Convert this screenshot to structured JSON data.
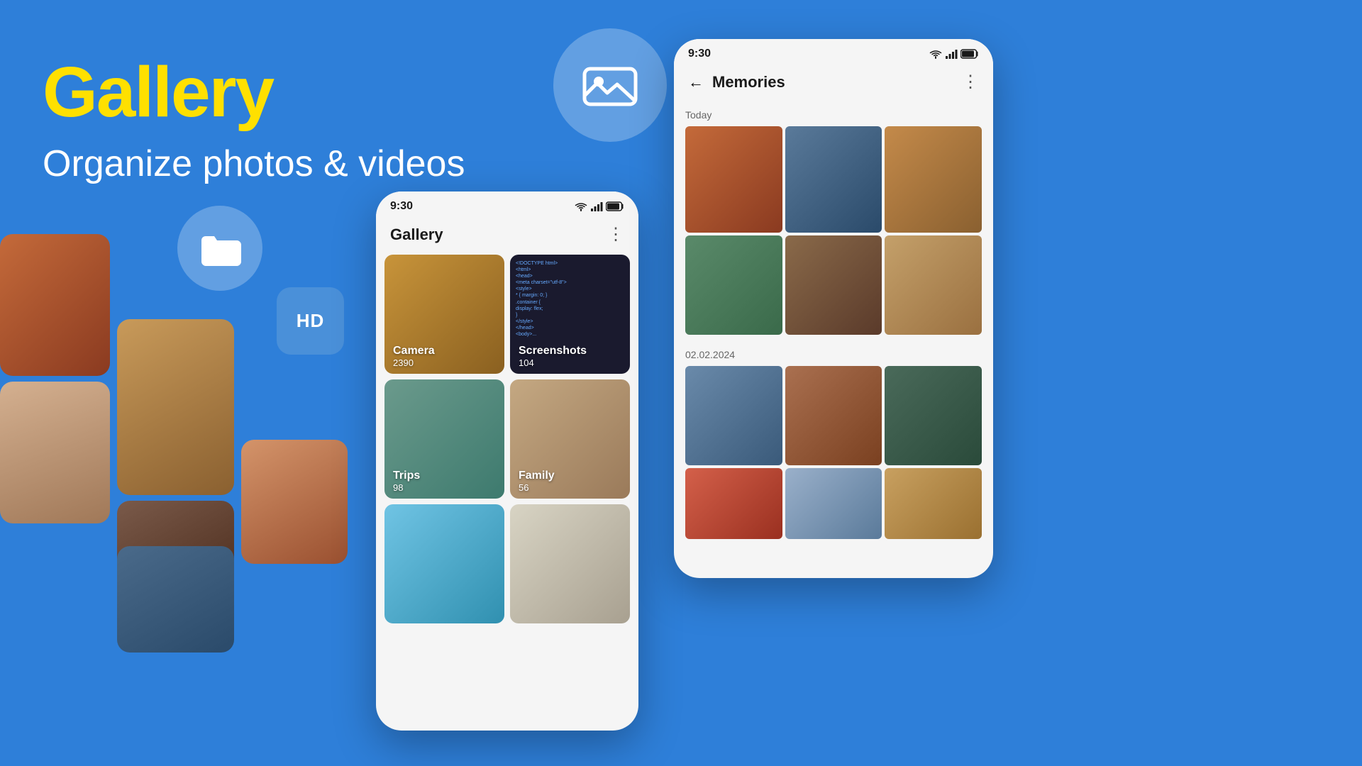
{
  "app": {
    "title": "Gallery",
    "subtitle": "Organize photos & videos",
    "bg_color": "#2E7FD9"
  },
  "icons": {
    "gallery_icon": "🖼",
    "folder_icon": "📁",
    "hd_label": "HD"
  },
  "phone_left": {
    "status_time": "9:30",
    "app_title": "Gallery",
    "menu_icon": "⋮",
    "tiles": [
      {
        "name": "Camera",
        "count": "2390",
        "style": "camera"
      },
      {
        "name": "Screenshots",
        "count": "104",
        "style": "screenshots"
      },
      {
        "name": "Trips",
        "count": "98",
        "style": "trips"
      },
      {
        "name": "Family",
        "count": "56",
        "style": "family"
      },
      {
        "name": "",
        "count": "",
        "style": "extra1"
      },
      {
        "name": "",
        "count": "",
        "style": "extra2"
      }
    ]
  },
  "phone_right": {
    "status_time": "9:30",
    "back_label": "←",
    "app_title": "Memories",
    "menu_icon": "⋮",
    "section_today": "Today",
    "section_date": "02.02.2024"
  },
  "status_icons": {
    "wifi": "wifi",
    "signal": "signal",
    "battery": "battery"
  }
}
